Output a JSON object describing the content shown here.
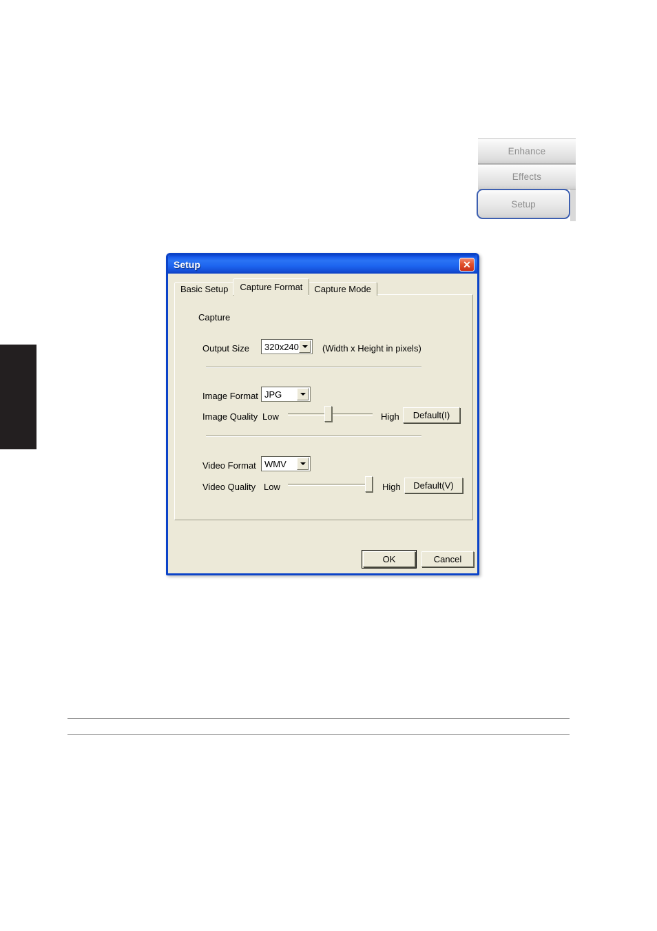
{
  "side_panel": {
    "buttons": [
      {
        "label": "Enhance",
        "state": "normal"
      },
      {
        "label": "Effects",
        "state": "normal"
      },
      {
        "label": "Setup",
        "state": "selected"
      }
    ]
  },
  "dialog": {
    "title": "Setup",
    "close_icon": "close-icon",
    "close_glyph": "✕",
    "tabs": [
      {
        "label": "Basic Setup",
        "active": false
      },
      {
        "label": "Capture Format",
        "active": true
      },
      {
        "label": "Capture Mode",
        "active": false
      }
    ],
    "group_label": "Capture",
    "fields": {
      "output_size": {
        "label": "Output Size",
        "value": "320x240",
        "hint": "(Width x Height in pixels)"
      },
      "image_format": {
        "label": "Image Format",
        "value": "JPG"
      },
      "image_quality": {
        "label": "Image Quality",
        "low": "Low",
        "high": "High",
        "percent": 47,
        "default_button": "Default(I)"
      },
      "video_format": {
        "label": "Video Format",
        "value": "WMV"
      },
      "video_quality": {
        "label": "Video Quality",
        "low": "Low",
        "high": "High",
        "percent": 100,
        "default_button": "Default(V)"
      }
    },
    "buttons": {
      "ok": "OK",
      "cancel": "Cancel"
    }
  },
  "colors": {
    "titlebar_blue": "#1a5cec",
    "dialog_face": "#ece9d8",
    "accent_border": "#3d5fb0",
    "close_red": "#e2512c"
  }
}
